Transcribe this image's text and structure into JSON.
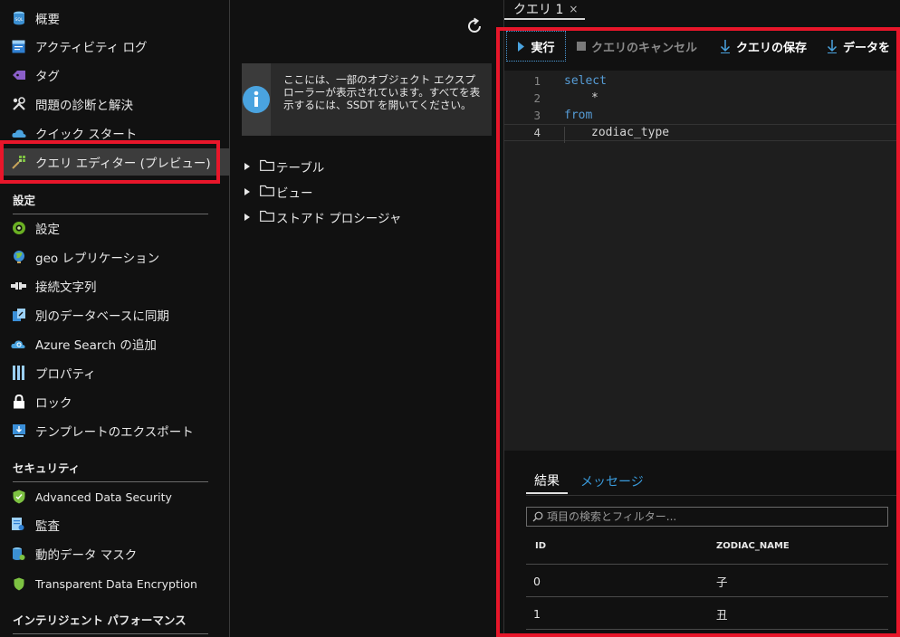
{
  "nav": {
    "items": [
      {
        "label": "概要",
        "icon": "sql-database-icon"
      },
      {
        "label": "アクティビティ ログ",
        "icon": "activity-log-icon"
      },
      {
        "label": "タグ",
        "icon": "tag-icon"
      },
      {
        "label": "問題の診断と解決",
        "icon": "wrench-icon"
      },
      {
        "label": "クイック スタート",
        "icon": "cloud-quickstart-icon"
      },
      {
        "label": "クエリ エディター (プレビュー)",
        "icon": "query-editor-icon"
      }
    ],
    "settings_section": "設定",
    "settings_items": [
      {
        "label": "設定",
        "icon": "settings-icon"
      },
      {
        "label": "geo レプリケーション",
        "icon": "globe-icon"
      },
      {
        "label": "接続文字列",
        "icon": "connection-icon"
      },
      {
        "label": "別のデータベースに同期",
        "icon": "sync-icon"
      },
      {
        "label": "Azure Search の追加",
        "icon": "azure-search-icon"
      },
      {
        "label": "プロパティ",
        "icon": "properties-icon"
      },
      {
        "label": "ロック",
        "icon": "lock-icon"
      },
      {
        "label": "テンプレートのエクスポート",
        "icon": "export-template-icon"
      }
    ],
    "security_section": "セキュリティ",
    "security_items": [
      {
        "label": "Advanced Data Security",
        "icon": "shield-icon"
      },
      {
        "label": "監査",
        "icon": "audit-icon"
      },
      {
        "label": "動的データ マスク",
        "icon": "data-mask-icon"
      },
      {
        "label": "Transparent Data Encryption",
        "icon": "encryption-shield-icon"
      }
    ],
    "intelligent_section": "インテリジェント パフォーマンス"
  },
  "object_explorer": {
    "info": "ここには、一部のオブジェクト エクスプローラーが表示されています。すべてを表示するには、SSDT を開いてください。",
    "tree": [
      "テーブル",
      "ビュー",
      "ストアド プロシージャ"
    ]
  },
  "query_editor": {
    "tab_title": "クエリ 1",
    "tab_close": "×",
    "toolbar": {
      "run": "実行",
      "cancel": "クエリのキャンセル",
      "save": "クエリの保存",
      "export": "データを"
    },
    "code_lines": [
      {
        "number": "1",
        "text": "select",
        "kind": "keyword"
      },
      {
        "number": "2",
        "text": "*",
        "kind": "plain"
      },
      {
        "number": "3",
        "text": "from",
        "kind": "keyword"
      },
      {
        "number": "4",
        "text": "zodiac_type",
        "kind": "plain"
      }
    ],
    "results": {
      "tab_results": "結果",
      "tab_messages": "メッセージ",
      "filter_placeholder": "項目の検索とフィルター...",
      "columns": [
        "ID",
        "ZODIAC_NAME"
      ],
      "rows": [
        [
          "0",
          "子"
        ],
        [
          "1",
          "丑"
        ]
      ]
    }
  },
  "colors": {
    "highlight_box": "#e8162a",
    "keyword": "#569cd6",
    "link": "#3a9bdc",
    "background": "#111111"
  }
}
